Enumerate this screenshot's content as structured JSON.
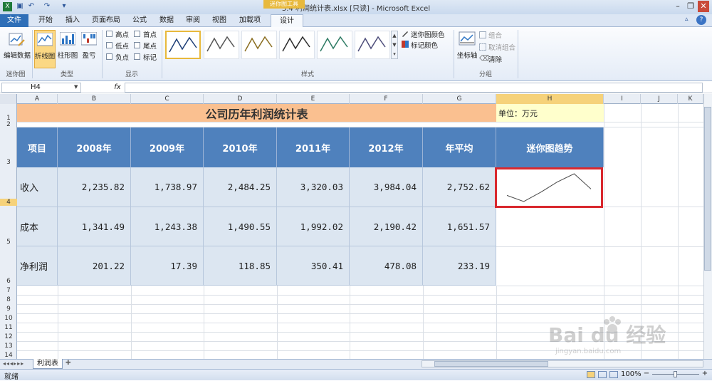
{
  "window": {
    "title": "3.4 利润统计表.xlsx  [只读]  -  Microsoft Excel",
    "context_tab_group": "迷你图工具"
  },
  "tabs": [
    {
      "label": "文件"
    },
    {
      "label": "开始"
    },
    {
      "label": "插入"
    },
    {
      "label": "页面布局"
    },
    {
      "label": "公式"
    },
    {
      "label": "数据"
    },
    {
      "label": "审阅"
    },
    {
      "label": "视图"
    },
    {
      "label": "加载项"
    },
    {
      "label": "设计"
    }
  ],
  "ribbon": {
    "sparkline_group": {
      "edit_data": "编辑数据",
      "label": "迷你图"
    },
    "type_group": {
      "line": "折线图",
      "column": "柱形图",
      "winloss": "盈亏",
      "label": "类型"
    },
    "show_group": {
      "high": "高点",
      "first": "首点",
      "low": "低点",
      "last": "尾点",
      "negative": "负点",
      "markers": "标记",
      "label": "显示"
    },
    "style_group": {
      "label": "样式",
      "sparkline_color": "迷你图颜色",
      "marker_color": "标记颜色"
    },
    "group_group": {
      "axis": "坐标轴",
      "group": "组合",
      "ungroup": "取消组合",
      "clear": "清除",
      "label": "分组"
    }
  },
  "formula_bar": {
    "name_box": "H4",
    "fx": "fx",
    "value": ""
  },
  "columns": [
    "A",
    "B",
    "C",
    "D",
    "E",
    "F",
    "G",
    "H",
    "I",
    "J",
    "K"
  ],
  "rows": [
    "1",
    "2",
    "3",
    "4",
    "5",
    "6",
    "7",
    "8",
    "9",
    "10",
    "11",
    "12",
    "13",
    "14"
  ],
  "sheet": {
    "title": "公司历年利润统计表",
    "unit": "单位：万元",
    "headers": [
      "项目",
      "2008年",
      "2009年",
      "2010年",
      "2011年",
      "2012年",
      "年平均",
      "迷你图趋势"
    ],
    "data_rows": [
      {
        "name": "收入",
        "values": [
          "2,235.82",
          "1,738.97",
          "2,484.25",
          "3,320.03",
          "3,984.04",
          "2,752.62"
        ]
      },
      {
        "name": "成本",
        "values": [
          "1,341.49",
          "1,243.38",
          "1,490.55",
          "1,992.02",
          "2,190.42",
          "1,651.57"
        ]
      },
      {
        "name": "净利润",
        "values": [
          "201.22",
          "17.39",
          "118.85",
          "350.41",
          "478.08",
          "233.19"
        ]
      }
    ],
    "sparkline_values": [
      2235.82,
      1738.97,
      2484.25,
      3320.03,
      3984.04,
      2752.62
    ]
  },
  "sheet_tabs": [
    {
      "label": "利润表"
    }
  ],
  "status": {
    "ready": "就绪",
    "zoom": "100%"
  },
  "colors": {
    "header_blue": "#4f81bd",
    "title_orange": "#fac090",
    "unit_yellow": "#ffffcc",
    "data_fill": "#dce6f1",
    "selection_red": "#d9282e"
  }
}
